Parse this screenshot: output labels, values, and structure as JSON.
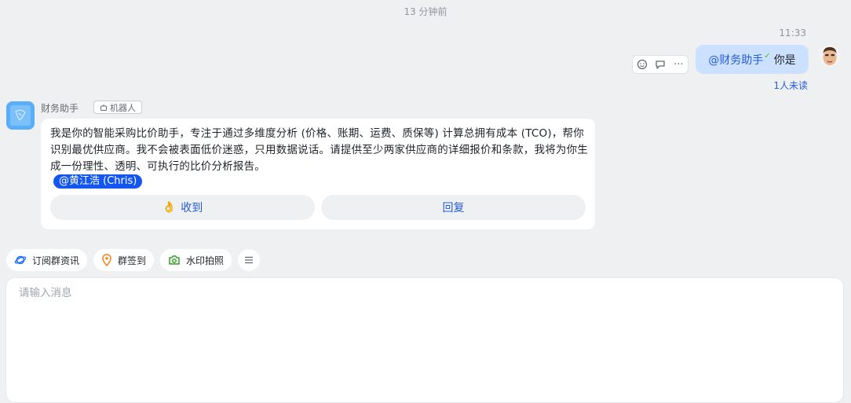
{
  "time_divider": "13 分钟前",
  "self_message": {
    "time": "11:33",
    "mention": "@财务助手",
    "text": "你是",
    "read_status": "1人未读"
  },
  "bot": {
    "name": "财务助手",
    "tag": "机器人",
    "message": "我是你的智能采购比价助手，专注于通过多维度分析 (价格、账期、运费、质保等) 计算总拥有成本 (TCO)，帮你识别最优供应商。我不会被表面低价迷惑，只用数据说话。请提供至少两家供应商的详细报价和条款，我将为你生成一份理性、透明、可执行的比价分析报告。",
    "mention": "@黄江浩 (Chris)",
    "buttons": {
      "ack": "收到",
      "reply": "回复"
    }
  },
  "quick_actions": [
    "订阅群资讯",
    "群签到",
    "水印拍照"
  ],
  "composer": {
    "placeholder": "请输入消息"
  },
  "colors": {
    "accent": "#245bdb",
    "bubble_self": "#cce0ff",
    "mention_chip": "#1456f0"
  }
}
